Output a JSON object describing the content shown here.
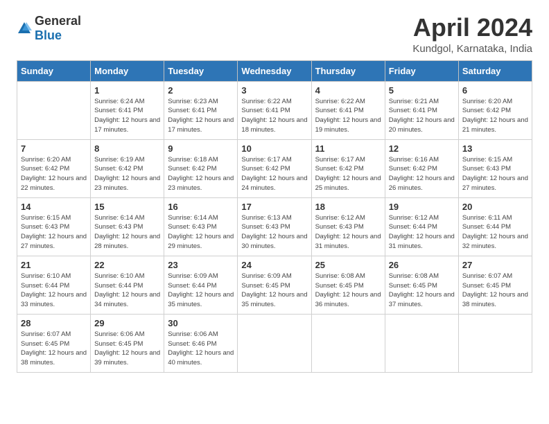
{
  "logo": {
    "general": "General",
    "blue": "Blue"
  },
  "title": "April 2024",
  "subtitle": "Kundgol, Karnataka, India",
  "headers": [
    "Sunday",
    "Monday",
    "Tuesday",
    "Wednesday",
    "Thursday",
    "Friday",
    "Saturday"
  ],
  "weeks": [
    [
      {
        "day": "",
        "sunrise": "",
        "sunset": "",
        "daylight": ""
      },
      {
        "day": "1",
        "sunrise": "Sunrise: 6:24 AM",
        "sunset": "Sunset: 6:41 PM",
        "daylight": "Daylight: 12 hours and 17 minutes."
      },
      {
        "day": "2",
        "sunrise": "Sunrise: 6:23 AM",
        "sunset": "Sunset: 6:41 PM",
        "daylight": "Daylight: 12 hours and 17 minutes."
      },
      {
        "day": "3",
        "sunrise": "Sunrise: 6:22 AM",
        "sunset": "Sunset: 6:41 PM",
        "daylight": "Daylight: 12 hours and 18 minutes."
      },
      {
        "day": "4",
        "sunrise": "Sunrise: 6:22 AM",
        "sunset": "Sunset: 6:41 PM",
        "daylight": "Daylight: 12 hours and 19 minutes."
      },
      {
        "day": "5",
        "sunrise": "Sunrise: 6:21 AM",
        "sunset": "Sunset: 6:41 PM",
        "daylight": "Daylight: 12 hours and 20 minutes."
      },
      {
        "day": "6",
        "sunrise": "Sunrise: 6:20 AM",
        "sunset": "Sunset: 6:42 PM",
        "daylight": "Daylight: 12 hours and 21 minutes."
      }
    ],
    [
      {
        "day": "7",
        "sunrise": "Sunrise: 6:20 AM",
        "sunset": "Sunset: 6:42 PM",
        "daylight": "Daylight: 12 hours and 22 minutes."
      },
      {
        "day": "8",
        "sunrise": "Sunrise: 6:19 AM",
        "sunset": "Sunset: 6:42 PM",
        "daylight": "Daylight: 12 hours and 23 minutes."
      },
      {
        "day": "9",
        "sunrise": "Sunrise: 6:18 AM",
        "sunset": "Sunset: 6:42 PM",
        "daylight": "Daylight: 12 hours and 23 minutes."
      },
      {
        "day": "10",
        "sunrise": "Sunrise: 6:17 AM",
        "sunset": "Sunset: 6:42 PM",
        "daylight": "Daylight: 12 hours and 24 minutes."
      },
      {
        "day": "11",
        "sunrise": "Sunrise: 6:17 AM",
        "sunset": "Sunset: 6:42 PM",
        "daylight": "Daylight: 12 hours and 25 minutes."
      },
      {
        "day": "12",
        "sunrise": "Sunrise: 6:16 AM",
        "sunset": "Sunset: 6:42 PM",
        "daylight": "Daylight: 12 hours and 26 minutes."
      },
      {
        "day": "13",
        "sunrise": "Sunrise: 6:15 AM",
        "sunset": "Sunset: 6:43 PM",
        "daylight": "Daylight: 12 hours and 27 minutes."
      }
    ],
    [
      {
        "day": "14",
        "sunrise": "Sunrise: 6:15 AM",
        "sunset": "Sunset: 6:43 PM",
        "daylight": "Daylight: 12 hours and 27 minutes."
      },
      {
        "day": "15",
        "sunrise": "Sunrise: 6:14 AM",
        "sunset": "Sunset: 6:43 PM",
        "daylight": "Daylight: 12 hours and 28 minutes."
      },
      {
        "day": "16",
        "sunrise": "Sunrise: 6:14 AM",
        "sunset": "Sunset: 6:43 PM",
        "daylight": "Daylight: 12 hours and 29 minutes."
      },
      {
        "day": "17",
        "sunrise": "Sunrise: 6:13 AM",
        "sunset": "Sunset: 6:43 PM",
        "daylight": "Daylight: 12 hours and 30 minutes."
      },
      {
        "day": "18",
        "sunrise": "Sunrise: 6:12 AM",
        "sunset": "Sunset: 6:43 PM",
        "daylight": "Daylight: 12 hours and 31 minutes."
      },
      {
        "day": "19",
        "sunrise": "Sunrise: 6:12 AM",
        "sunset": "Sunset: 6:44 PM",
        "daylight": "Daylight: 12 hours and 31 minutes."
      },
      {
        "day": "20",
        "sunrise": "Sunrise: 6:11 AM",
        "sunset": "Sunset: 6:44 PM",
        "daylight": "Daylight: 12 hours and 32 minutes."
      }
    ],
    [
      {
        "day": "21",
        "sunrise": "Sunrise: 6:10 AM",
        "sunset": "Sunset: 6:44 PM",
        "daylight": "Daylight: 12 hours and 33 minutes."
      },
      {
        "day": "22",
        "sunrise": "Sunrise: 6:10 AM",
        "sunset": "Sunset: 6:44 PM",
        "daylight": "Daylight: 12 hours and 34 minutes."
      },
      {
        "day": "23",
        "sunrise": "Sunrise: 6:09 AM",
        "sunset": "Sunset: 6:44 PM",
        "daylight": "Daylight: 12 hours and 35 minutes."
      },
      {
        "day": "24",
        "sunrise": "Sunrise: 6:09 AM",
        "sunset": "Sunset: 6:45 PM",
        "daylight": "Daylight: 12 hours and 35 minutes."
      },
      {
        "day": "25",
        "sunrise": "Sunrise: 6:08 AM",
        "sunset": "Sunset: 6:45 PM",
        "daylight": "Daylight: 12 hours and 36 minutes."
      },
      {
        "day": "26",
        "sunrise": "Sunrise: 6:08 AM",
        "sunset": "Sunset: 6:45 PM",
        "daylight": "Daylight: 12 hours and 37 minutes."
      },
      {
        "day": "27",
        "sunrise": "Sunrise: 6:07 AM",
        "sunset": "Sunset: 6:45 PM",
        "daylight": "Daylight: 12 hours and 38 minutes."
      }
    ],
    [
      {
        "day": "28",
        "sunrise": "Sunrise: 6:07 AM",
        "sunset": "Sunset: 6:45 PM",
        "daylight": "Daylight: 12 hours and 38 minutes."
      },
      {
        "day": "29",
        "sunrise": "Sunrise: 6:06 AM",
        "sunset": "Sunset: 6:45 PM",
        "daylight": "Daylight: 12 hours and 39 minutes."
      },
      {
        "day": "30",
        "sunrise": "Sunrise: 6:06 AM",
        "sunset": "Sunset: 6:46 PM",
        "daylight": "Daylight: 12 hours and 40 minutes."
      },
      {
        "day": "",
        "sunrise": "",
        "sunset": "",
        "daylight": ""
      },
      {
        "day": "",
        "sunrise": "",
        "sunset": "",
        "daylight": ""
      },
      {
        "day": "",
        "sunrise": "",
        "sunset": "",
        "daylight": ""
      },
      {
        "day": "",
        "sunrise": "",
        "sunset": "",
        "daylight": ""
      }
    ]
  ]
}
